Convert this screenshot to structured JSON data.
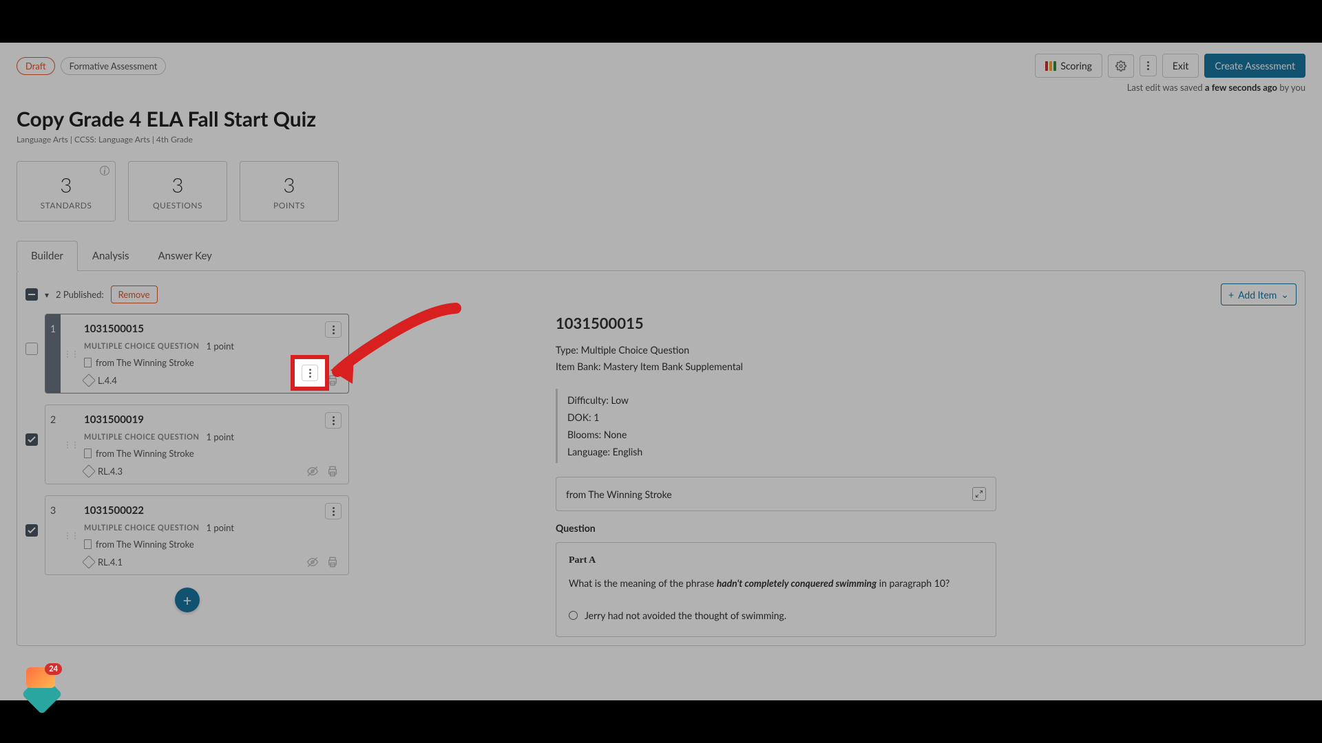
{
  "badges": {
    "draft": "Draft",
    "formative": "Formative Assessment"
  },
  "toolbar": {
    "scoring": "Scoring",
    "exit": "Exit",
    "create": "Create Assessment"
  },
  "last_edit": {
    "prefix": "Last edit was saved ",
    "time": "a few seconds ago",
    "suffix": " by you"
  },
  "page": {
    "title": "Copy Grade 4 ELA Fall Start Quiz",
    "subtitle": "Language Arts  |  CCSS: Language Arts  |  4th Grade"
  },
  "stats": [
    {
      "value": "3",
      "label": "STANDARDS",
      "info": true
    },
    {
      "value": "3",
      "label": "QUESTIONS",
      "info": false
    },
    {
      "value": "3",
      "label": "POINTS",
      "info": false
    }
  ],
  "tabs": {
    "builder": "Builder",
    "analysis": "Analysis",
    "answer_key": "Answer Key"
  },
  "list_bar": {
    "published": "2 Published:",
    "remove": "Remove",
    "add_item": "Add Item"
  },
  "items": [
    {
      "num": "1",
      "id": "1031500015",
      "type": "MULTIPLE CHOICE QUESTION",
      "points": "1 point",
      "source": "from The Winning Stroke",
      "standard": "L.4.4",
      "selected": true,
      "checked": false
    },
    {
      "num": "2",
      "id": "1031500019",
      "type": "MULTIPLE CHOICE QUESTION",
      "points": "1 point",
      "source": "from The Winning Stroke",
      "standard": "RL.4.3",
      "selected": false,
      "checked": true
    },
    {
      "num": "3",
      "id": "1031500022",
      "type": "MULTIPLE CHOICE QUESTION",
      "points": "1 point",
      "source": "from The Winning Stroke",
      "standard": "RL.4.1",
      "selected": false,
      "checked": true
    }
  ],
  "detail": {
    "id": "1031500015",
    "type_label": "Type: Multiple Choice Question",
    "bank_label": "Item Bank: Mastery Item Bank Supplemental",
    "attrs": {
      "difficulty": "Difficulty: Low",
      "dok": "DOK: 1",
      "blooms": "Blooms: None",
      "language": "Language: English"
    },
    "passage": "from The Winning Stroke",
    "question_label": "Question",
    "part": "Part A",
    "stem_pre": "What is the meaning of the phrase ",
    "stem_em": "hadn't completely conquered swimming",
    "stem_post": " in paragraph 10?",
    "answer_a": "Jerry had not avoided the thought of swimming."
  },
  "chat": {
    "badge": "24"
  },
  "colors": {
    "scoring_bars": [
      "#d32f2f",
      "#f9a825",
      "#388e3c"
    ]
  }
}
